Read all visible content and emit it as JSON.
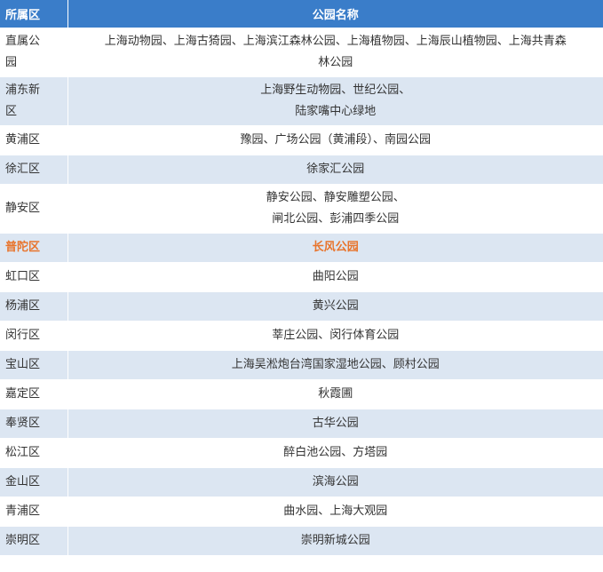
{
  "table": {
    "headers": {
      "district": "所属区",
      "parks": "公园名称"
    },
    "rows": [
      {
        "district_lines": [
          "直属公",
          "园"
        ],
        "park_lines": [
          "上海动物园、上海古猗园、上海滨江森林公园、上海植物园、上海辰山植物园、上海共青森",
          "林公园"
        ]
      },
      {
        "district_lines": [
          "浦东新",
          "区"
        ],
        "park_lines": [
          "上海野生动物园、世纪公园、",
          "陆家嘴中心绿地"
        ]
      },
      {
        "district_lines": [
          "黄浦区"
        ],
        "park_lines": [
          "豫园、广场公园（黄浦段）、南园公园"
        ]
      },
      {
        "district_lines": [
          "徐汇区"
        ],
        "park_lines": [
          "徐家汇公园"
        ]
      },
      {
        "district_lines": [
          "静安区"
        ],
        "park_lines": [
          "静安公园、静安雕塑公园、",
          "闸北公园、彭浦四季公园"
        ]
      },
      {
        "district_lines": [
          "普陀区"
        ],
        "park_lines": [
          "长风公园"
        ],
        "highlight": true
      },
      {
        "district_lines": [
          "虹口区"
        ],
        "park_lines": [
          "曲阳公园"
        ]
      },
      {
        "district_lines": [
          "杨浦区"
        ],
        "park_lines": [
          "黄兴公园"
        ]
      },
      {
        "district_lines": [
          "闵行区"
        ],
        "park_lines": [
          "莘庄公园、闵行体育公园"
        ]
      },
      {
        "district_lines": [
          "宝山区"
        ],
        "park_lines": [
          "上海吴淞炮台湾国家湿地公园、顾村公园"
        ]
      },
      {
        "district_lines": [
          "嘉定区"
        ],
        "park_lines": [
          "秋霞圃"
        ]
      },
      {
        "district_lines": [
          "奉贤区"
        ],
        "park_lines": [
          "古华公园"
        ]
      },
      {
        "district_lines": [
          "松江区"
        ],
        "park_lines": [
          "醉白池公园、方塔园"
        ]
      },
      {
        "district_lines": [
          "金山区"
        ],
        "park_lines": [
          "滨海公园"
        ]
      },
      {
        "district_lines": [
          "青浦区"
        ],
        "park_lines": [
          "曲水园、上海大观园"
        ]
      },
      {
        "district_lines": [
          "崇明区"
        ],
        "park_lines": [
          "崇明新城公园"
        ]
      }
    ]
  },
  "colors": {
    "header_bg": "#3a7dc9",
    "header_text": "#ffffff",
    "row_alt_bg": "#dce6f2",
    "highlight_text": "#e8742c",
    "body_text": "#333333"
  }
}
